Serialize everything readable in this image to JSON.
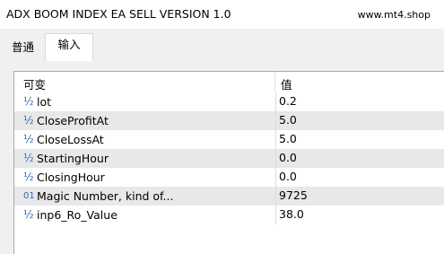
{
  "window": {
    "title": "ADX BOOM INDEX EA SELL VERSION 1.0",
    "site": "www.mt4.shop"
  },
  "tabs": [
    {
      "label": "普通",
      "active": false
    },
    {
      "label": "输入",
      "active": true
    }
  ],
  "grid": {
    "columns": {
      "variable": "可变",
      "value": "值"
    },
    "rows": [
      {
        "icon": "½",
        "icon_name": "double-type-icon",
        "name": "lot",
        "value": "0.2"
      },
      {
        "icon": "½",
        "icon_name": "double-type-icon",
        "name": "CloseProfitAt",
        "value": "5.0"
      },
      {
        "icon": "½",
        "icon_name": "double-type-icon",
        "name": "CloseLossAt",
        "value": "5.0"
      },
      {
        "icon": "½",
        "icon_name": "double-type-icon",
        "name": "StartingHour",
        "value": "0.0"
      },
      {
        "icon": "½",
        "icon_name": "double-type-icon",
        "name": "ClosingHour",
        "value": "0.0"
      },
      {
        "icon": "01",
        "icon_name": "integer-type-icon",
        "name": "Magic Number, kind of...",
        "value": "9725"
      },
      {
        "icon": "½",
        "icon_name": "double-type-icon",
        "name": "inp6_Ro_Value",
        "value": "38.0"
      }
    ]
  },
  "colors": {
    "icon": "#2b6cb8",
    "alt_row": "#e8e8e8",
    "panel_bg": "#f0f0f0"
  }
}
